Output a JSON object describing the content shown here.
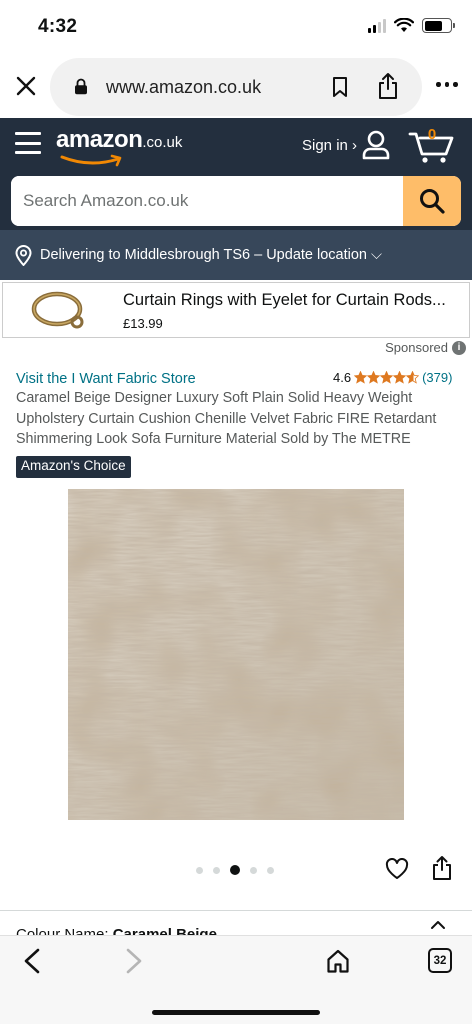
{
  "status_bar": {
    "time": "4:32"
  },
  "browser": {
    "url": "www.amazon.co.uk"
  },
  "header": {
    "logo_text": "amazon",
    "logo_suffix": ".co.uk",
    "sign_in": "Sign in ›",
    "cart_count": "0",
    "brand_color": "#232f3e",
    "accent_color": "#febd69"
  },
  "search": {
    "placeholder": "Search Amazon.co.uk"
  },
  "delivery": {
    "text": "Delivering to Middlesbrough TS6 – Update location ⌵"
  },
  "sponsored_ad": {
    "title": "Curtain Rings with Eyelet for Curtain Rods...",
    "price": "£13.99",
    "sponsored_label": "Sponsored",
    "info_glyph": "i"
  },
  "product": {
    "store_link": "Visit the I Want Fabric Store",
    "rating_value": "4.6",
    "rating_stars": 4.6,
    "rating_count": "(379)",
    "title": "Caramel Beige Designer Luxury Soft Plain Solid Heavy Weight Upholstery Curtain Cushion Chenille Velvet Fabric FIRE Retardant Shimmering Look Sofa Furniture Material Sold by The METRE",
    "badge": "Amazon's Choice",
    "image_count": 5,
    "active_image": 3
  },
  "variation": {
    "label": "Colour Name:",
    "value": "Caramel Beige"
  },
  "toolbar": {
    "tabs_count": "32"
  }
}
